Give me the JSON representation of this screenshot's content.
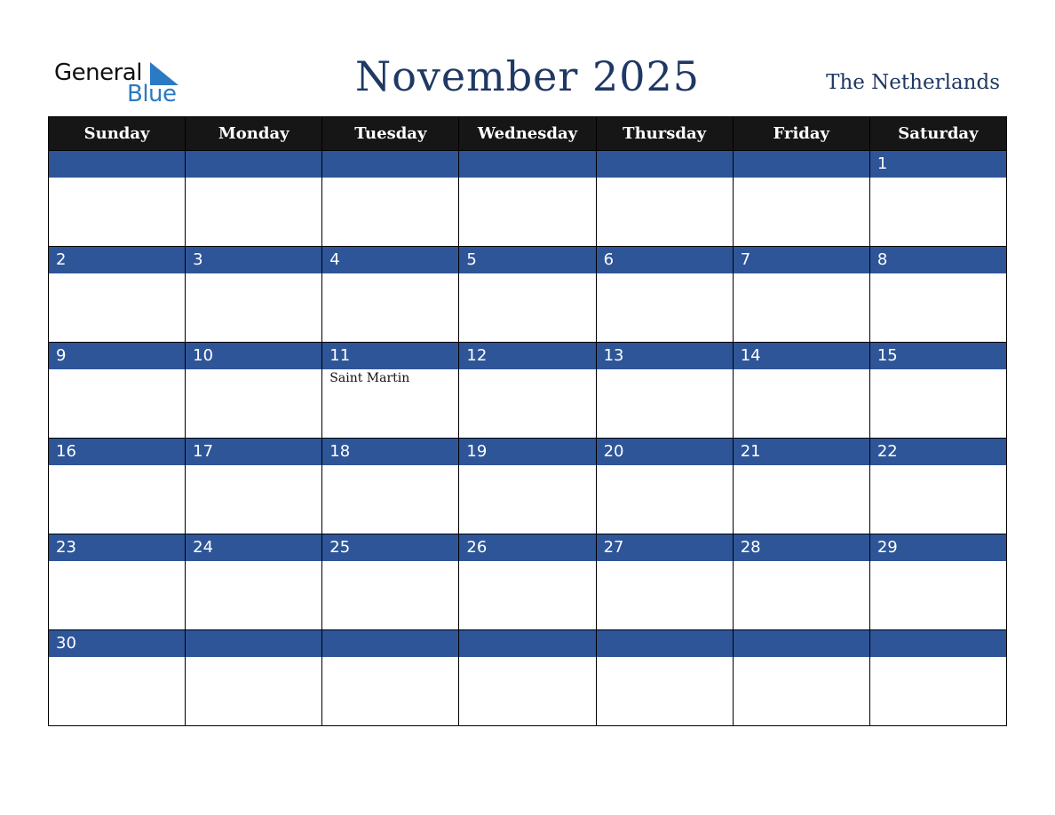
{
  "logo": {
    "word1": "General",
    "word2": "Blue"
  },
  "header": {
    "title": "November 2025",
    "country": "The Netherlands"
  },
  "colors": {
    "header_bg": "#161616",
    "day_bar": "#2e5597",
    "title": "#1f3864",
    "logo_blue": "#2a7ac4"
  },
  "weekdays": [
    "Sunday",
    "Monday",
    "Tuesday",
    "Wednesday",
    "Thursday",
    "Friday",
    "Saturday"
  ],
  "weeks": [
    [
      {
        "day": "",
        "holiday": ""
      },
      {
        "day": "",
        "holiday": ""
      },
      {
        "day": "",
        "holiday": ""
      },
      {
        "day": "",
        "holiday": ""
      },
      {
        "day": "",
        "holiday": ""
      },
      {
        "day": "",
        "holiday": ""
      },
      {
        "day": "1",
        "holiday": ""
      }
    ],
    [
      {
        "day": "2",
        "holiday": ""
      },
      {
        "day": "3",
        "holiday": ""
      },
      {
        "day": "4",
        "holiday": ""
      },
      {
        "day": "5",
        "holiday": ""
      },
      {
        "day": "6",
        "holiday": ""
      },
      {
        "day": "7",
        "holiday": ""
      },
      {
        "day": "8",
        "holiday": ""
      }
    ],
    [
      {
        "day": "9",
        "holiday": ""
      },
      {
        "day": "10",
        "holiday": ""
      },
      {
        "day": "11",
        "holiday": "Saint Martin"
      },
      {
        "day": "12",
        "holiday": ""
      },
      {
        "day": "13",
        "holiday": ""
      },
      {
        "day": "14",
        "holiday": ""
      },
      {
        "day": "15",
        "holiday": ""
      }
    ],
    [
      {
        "day": "16",
        "holiday": ""
      },
      {
        "day": "17",
        "holiday": ""
      },
      {
        "day": "18",
        "holiday": ""
      },
      {
        "day": "19",
        "holiday": ""
      },
      {
        "day": "20",
        "holiday": ""
      },
      {
        "day": "21",
        "holiday": ""
      },
      {
        "day": "22",
        "holiday": ""
      }
    ],
    [
      {
        "day": "23",
        "holiday": ""
      },
      {
        "day": "24",
        "holiday": ""
      },
      {
        "day": "25",
        "holiday": ""
      },
      {
        "day": "26",
        "holiday": ""
      },
      {
        "day": "27",
        "holiday": ""
      },
      {
        "day": "28",
        "holiday": ""
      },
      {
        "day": "29",
        "holiday": ""
      }
    ],
    [
      {
        "day": "30",
        "holiday": ""
      },
      {
        "day": "",
        "holiday": ""
      },
      {
        "day": "",
        "holiday": ""
      },
      {
        "day": "",
        "holiday": ""
      },
      {
        "day": "",
        "holiday": ""
      },
      {
        "day": "",
        "holiday": ""
      },
      {
        "day": "",
        "holiday": ""
      }
    ]
  ]
}
